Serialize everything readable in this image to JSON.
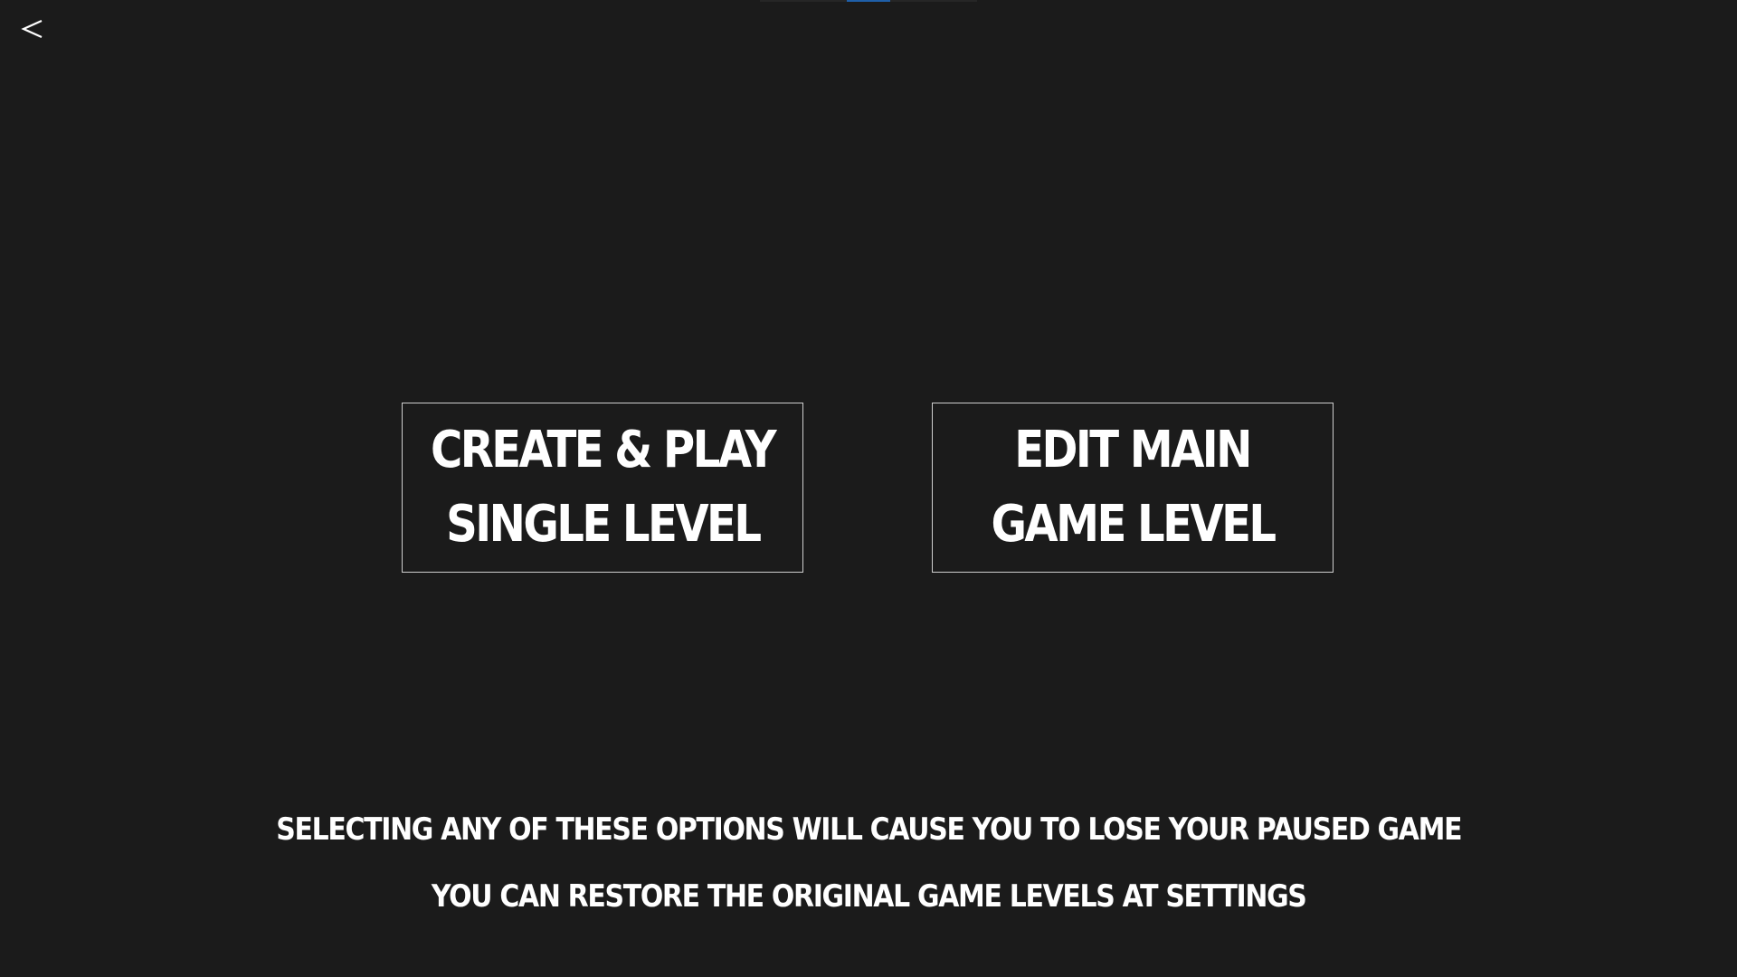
{
  "colors": {
    "background": "#1b1b1b",
    "text": "#ffffff",
    "button_border": "#cfcfcf",
    "indicator_active": "#1f5fa8"
  },
  "header": {
    "back_icon": "chevron-left-icon"
  },
  "buttons": {
    "create_play": {
      "line1": "CREATE & PLAY",
      "line2": "SINGLE LEVEL"
    },
    "edit_main": {
      "line1": "EDIT MAIN",
      "line2": "GAME LEVEL"
    }
  },
  "notices": {
    "warning": "SELECTING ANY OF THESE OPTIONS WILL CAUSE YOU TO LOSE YOUR PAUSED GAME",
    "restore": "YOU CAN RESTORE THE ORIGINAL GAME LEVELS AT SETTINGS"
  }
}
